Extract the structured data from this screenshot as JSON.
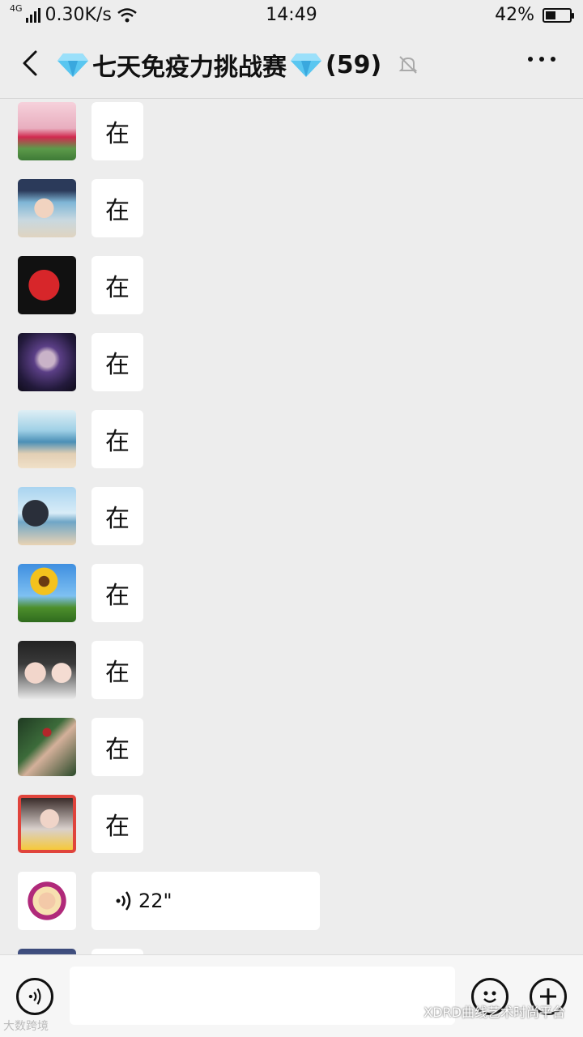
{
  "status_bar": {
    "network_type": "4G",
    "speed": "0.30K/s",
    "time": "14:49",
    "battery_percent_text": "42%",
    "battery_level": 0.42
  },
  "header": {
    "title": "七天免疫力挑战赛",
    "member_count": "(59)",
    "icons": [
      "back-icon",
      "diamond-icon",
      "muted-bell-icon",
      "more-icon"
    ]
  },
  "messages": [
    {
      "avatar": "avatar-girl-pink",
      "text": "在"
    },
    {
      "avatar": "avatar-woman-cap",
      "text": "在"
    },
    {
      "avatar": "avatar-2019-poster",
      "text": "在"
    },
    {
      "avatar": "avatar-anime-girl",
      "text": "在"
    },
    {
      "avatar": "avatar-beach-text",
      "text": "在"
    },
    {
      "avatar": "avatar-man-seaside",
      "text": "在"
    },
    {
      "avatar": "avatar-sunflower",
      "text": "在"
    },
    {
      "avatar": "avatar-two-women",
      "text": "在"
    },
    {
      "avatar": "avatar-hand-berries",
      "text": "在"
    },
    {
      "avatar": "avatar-woman-70",
      "text": "在"
    },
    {
      "avatar": "avatar-badge-woman",
      "type": "voice",
      "duration": "22\""
    }
  ],
  "colors": {
    "background": "#ededed",
    "bubble": "#ffffff",
    "header_divider": "#d6d6d6"
  },
  "watermarks": {
    "left": "大数跨境",
    "right": "XDRD曲线艺术时尚平台"
  }
}
